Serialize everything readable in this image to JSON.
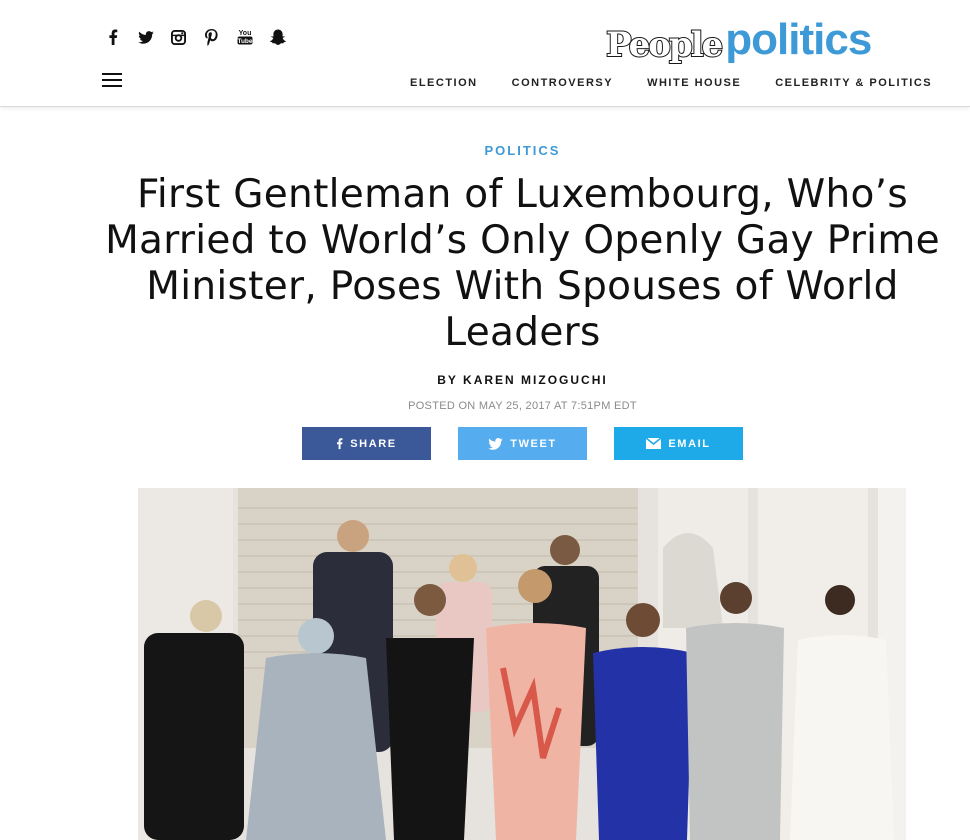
{
  "header": {
    "social_icons": [
      "facebook-icon",
      "twitter-icon",
      "instagram-icon",
      "pinterest-icon",
      "youtube-icon",
      "snapchat-icon"
    ],
    "youtube_text": "You Tube",
    "logo_people": "People",
    "logo_politics": "politics",
    "nav": [
      "ELECTION",
      "CONTROVERSY",
      "WHITE HOUSE",
      "CELEBRITY & POLITICS"
    ]
  },
  "article": {
    "kicker": "POLITICS",
    "headline": "First Gentleman of Luxembourg, Who’s Married to World’s Only Openly Gay Prime Minister, Poses With Spouses of World Leaders",
    "byline": "BY KAREN MIZOGUCHI",
    "posted": "POSTED ON MAY 25, 2017 AT 7:51PM EDT",
    "share": {
      "facebook": "SHARE",
      "twitter": "TWEET",
      "email": "EMAIL"
    }
  },
  "colors": {
    "accent": "#3d9ad6",
    "facebook": "#3b5998",
    "twitter": "#55acee",
    "email": "#1eaae8"
  }
}
